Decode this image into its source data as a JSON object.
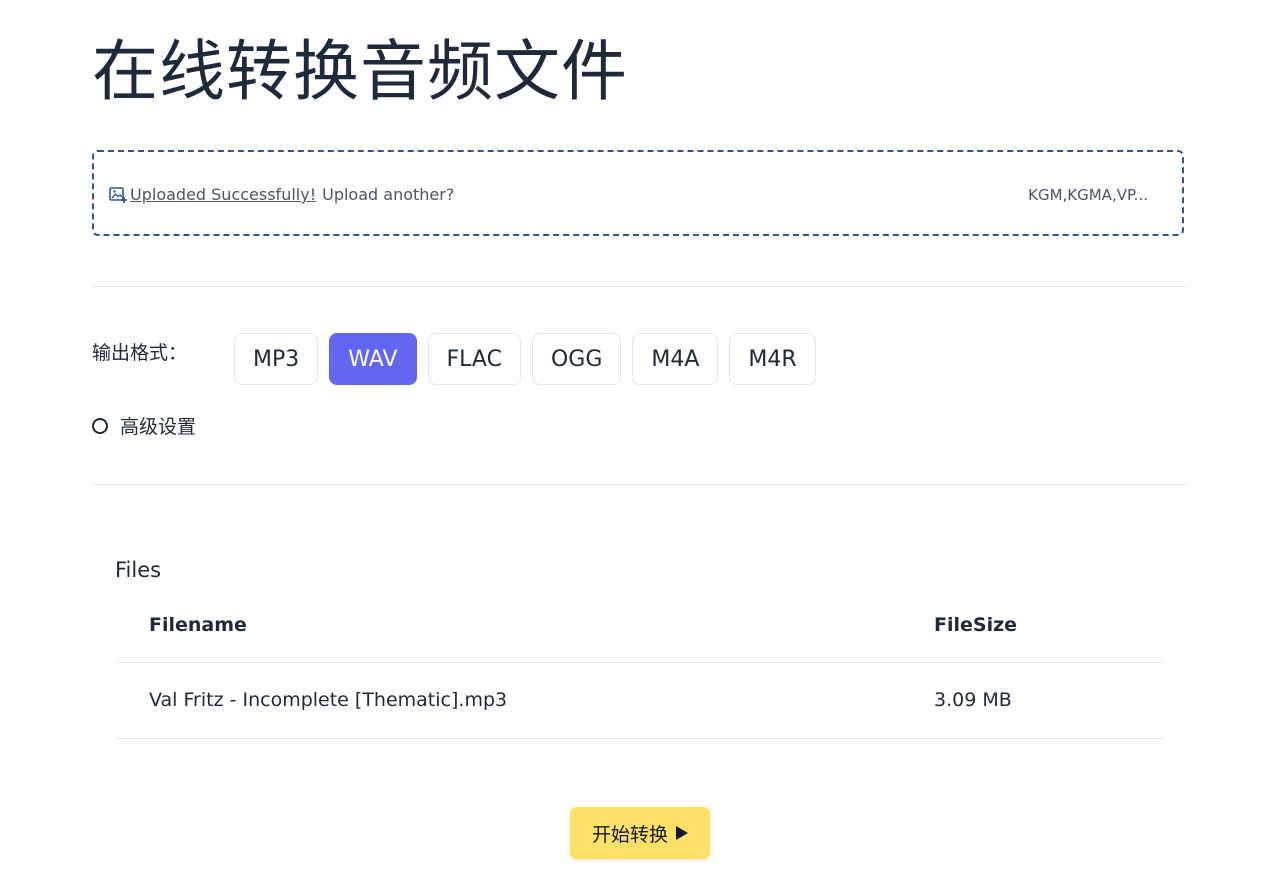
{
  "page": {
    "title": "在线转换音频文件"
  },
  "upload": {
    "success_text": "Uploaded Successfully!",
    "another_text": "Upload another?",
    "supported_formats": "KGM,KGMA,VP...",
    "icon": "image-upload-icon",
    "border_color": "#2f5592"
  },
  "output": {
    "label": "输出格式：",
    "formats": [
      {
        "label": "MP3",
        "selected": false
      },
      {
        "label": "WAV",
        "selected": true
      },
      {
        "label": "FLAC",
        "selected": false
      },
      {
        "label": "OGG",
        "selected": false
      },
      {
        "label": "M4A",
        "selected": false
      },
      {
        "label": "M4R",
        "selected": false
      }
    ],
    "selected_color": "#6366f1"
  },
  "advanced": {
    "label": "高级设置",
    "checked": false
  },
  "files": {
    "heading": "Files",
    "columns": [
      "Filename",
      "FileSize"
    ],
    "rows": [
      {
        "filename": "Val Fritz - Incomplete [Thematic].mp3",
        "size": "3.09 MB"
      }
    ]
  },
  "actions": {
    "start_label": "开始转换",
    "start_color": "#fde068",
    "start_icon": "play-icon"
  }
}
